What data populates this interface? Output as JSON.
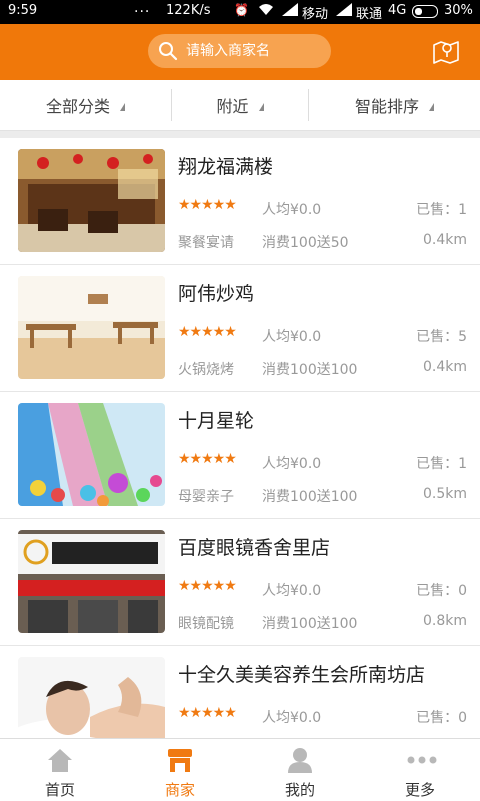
{
  "status_bar": {
    "time": "9:59",
    "dots": "...",
    "speed": "122K/s",
    "carrier1": "移动",
    "carrier2": "联通",
    "network": "4G",
    "battery": "30%"
  },
  "header": {
    "search_placeholder": "请输入商家名",
    "map_icon": "map-icon"
  },
  "filters": [
    {
      "label": "全部分类"
    },
    {
      "label": "附近"
    },
    {
      "label": "智能排序"
    }
  ],
  "merchants": [
    {
      "name": "翔龙福满楼",
      "rating": 5,
      "stars": "★★★★★",
      "avg_price": "人均¥0.0",
      "sold": "已售：1",
      "category": "聚餐宴请",
      "promo": "消费100送50",
      "distance": "0.4km",
      "image": "restaurant-interior"
    },
    {
      "name": "阿伟炒鸡",
      "rating": 5,
      "stars": "★★★★★",
      "avg_price": "人均¥0.0",
      "sold": "已售：5",
      "category": "火锅烧烤",
      "promo": "消费100送100",
      "distance": "0.4km",
      "image": "dining-hall"
    },
    {
      "name": "十月星轮",
      "rating": 5,
      "stars": "★★★★★",
      "avg_price": "人均¥0.0",
      "sold": "已售：1",
      "category": "母婴亲子",
      "promo": "消费100送100",
      "distance": "0.5km",
      "image": "ball-pit-slides"
    },
    {
      "name": "百度眼镜香舍里店",
      "rating": 5,
      "stars": "★★★★★",
      "avg_price": "人均¥0.0",
      "sold": "已售：0",
      "category": "眼镜配镜",
      "promo": "消费100送100",
      "distance": "0.8km",
      "image": "storefront-sign"
    },
    {
      "name": "十全久美美容养生会所南坊店",
      "rating": 5,
      "stars": "★★★★★",
      "avg_price": "人均¥0.0",
      "sold": "已售：0",
      "category": "",
      "promo": "",
      "distance": "",
      "image": "spa-massage"
    }
  ],
  "tabbar": [
    {
      "label": "首页",
      "icon": "home-icon",
      "active": false
    },
    {
      "label": "商家",
      "icon": "shop-icon",
      "active": true
    },
    {
      "label": "我的",
      "icon": "person-icon",
      "active": false
    },
    {
      "label": "更多",
      "icon": "more-icon",
      "active": false
    }
  ],
  "colors": {
    "accent": "#f0780a",
    "search_bg": "#f7a350",
    "star": "#f07a12"
  }
}
